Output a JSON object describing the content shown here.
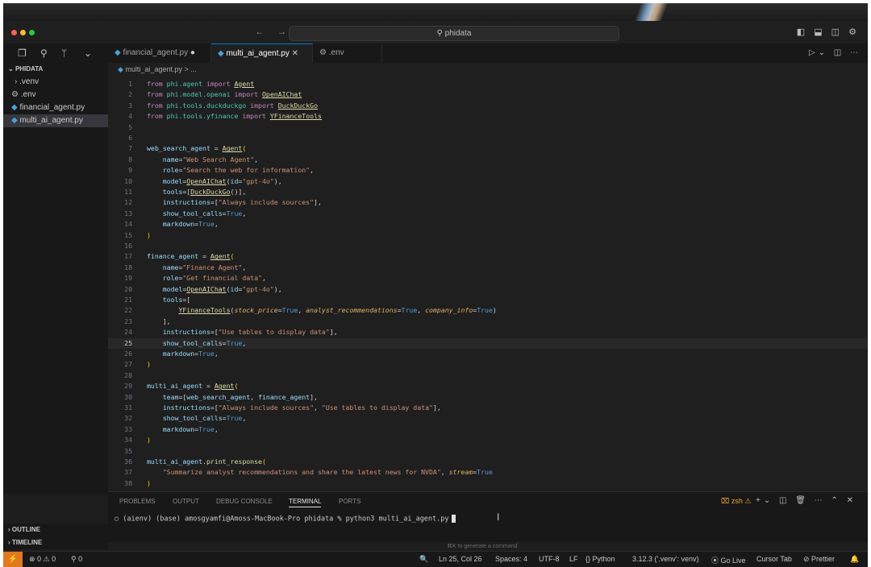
{
  "titlebar": {
    "search_text": "phidata",
    "nav_arrows": "← →"
  },
  "sidebar": {
    "header": "PHIDATA",
    "items": [
      {
        "label": ".venv",
        "icon": "chevron-right-icon"
      },
      {
        "label": ".env",
        "icon": "gear-icon"
      },
      {
        "label": "financial_agent.py",
        "icon": "python-icon"
      },
      {
        "label": "multi_ai_agent.py",
        "icon": "python-icon",
        "selected": true
      }
    ],
    "outline": "OUTLINE",
    "timeline": "TIMELINE"
  },
  "tabs": [
    {
      "label": "financial_agent.py",
      "modified": "●"
    },
    {
      "label": "multi_ai_agent.py",
      "close": "✕",
      "active": true
    },
    {
      "label": ".env"
    }
  ],
  "breadcrumb": "multi_ai_agent.py > ...",
  "editor": {
    "current_line": 25,
    "lines": [
      {
        "n": "1",
        "html": "<span class='kw'>from</span> <span class='mod'>phi.agent</span> <span class='kw'>import</span> <span class='cls'>Agent</span>"
      },
      {
        "n": "2",
        "html": "<span class='kw'>from</span> <span class='mod'>phi.model.openai</span> <span class='kw'>import</span> <span class='cls'>OpenAIChat</span>"
      },
      {
        "n": "3",
        "html": "<span class='kw'>from</span> <span class='mod'>phi.tools.duckduckgo</span> <span class='kw'>import</span> <span class='cls'>DuckDuckGo</span>"
      },
      {
        "n": "4",
        "html": "<span class='kw'>from</span> <span class='mod'>phi.tools.yfinance</span> <span class='kw'>import</span> <span class='cls'>YFinanceTools</span>"
      },
      {
        "n": "5",
        "html": ""
      },
      {
        "n": "6",
        "html": ""
      },
      {
        "n": "7",
        "html": "<span class='var'>web_search_agent</span> = <span class='cls'>Agent</span><span class='brk'>(</span>"
      },
      {
        "n": "8",
        "html": "    <span class='var'>name</span>=<span class='str'>\"Web Search Agent\"</span>,"
      },
      {
        "n": "9",
        "html": "    <span class='var'>role</span>=<span class='str'>\"Search the web for information\"</span>,"
      },
      {
        "n": "10",
        "html": "    <span class='var'>model</span>=<span class='cls'>OpenAIChat</span>(<span class='var'>id</span>=<span class='str'>\"gpt-4o\"</span>),"
      },
      {
        "n": "11",
        "html": "    <span class='var'>tools</span>=[<span class='cls'>DuckDuckGo</span>()],"
      },
      {
        "n": "12",
        "html": "    <span class='var'>instructions</span>=[<span class='str'>\"Always include sources\"</span>],"
      },
      {
        "n": "13",
        "html": "    <span class='var'>show_tool_calls</span>=<span class='const'>True</span>,"
      },
      {
        "n": "14",
        "html": "    <span class='var'>markdown</span>=<span class='const'>True</span>,"
      },
      {
        "n": "15",
        "html": "<span class='brk'>)</span>"
      },
      {
        "n": "16",
        "html": ""
      },
      {
        "n": "17",
        "html": "<span class='var'>finance_agent</span> = <span class='cls'>Agent</span><span class='brk'>(</span>"
      },
      {
        "n": "18",
        "html": "    <span class='var'>name</span>=<span class='str'>\"Finance Agent\"</span>,"
      },
      {
        "n": "19",
        "html": "    <span class='var'>role</span>=<span class='str'>\"Get financial data\"</span>,"
      },
      {
        "n": "20",
        "html": "    <span class='var'>model</span>=<span class='cls'>OpenAIChat</span>(<span class='var'>id</span>=<span class='str'>\"gpt-4o\"</span>),"
      },
      {
        "n": "21",
        "html": "    <span class='var'>tools</span>=["
      },
      {
        "n": "22",
        "html": "        <span class='cls'>YFinanceTools</span>(<span class='kwarg'>stock_price</span>=<span class='const'>True</span>, <span class='kwarg'>analyst_recommendations</span>=<span class='const'>True</span>, <span class='kwarg'>company_info</span>=<span class='const'>True</span>)"
      },
      {
        "n": "23",
        "html": "    ],"
      },
      {
        "n": "24",
        "html": "    <span class='var'>instructions</span>=[<span class='str'>\"Use tables to display data\"</span>],"
      },
      {
        "n": "25",
        "html": "    <span class='var'>show_tool_calls</span>=<span class='const'>True</span>,"
      },
      {
        "n": "26",
        "html": "    <span class='var'>markdown</span>=<span class='const'>True</span>,"
      },
      {
        "n": "27",
        "html": "<span class='brk'>)</span>"
      },
      {
        "n": "28",
        "html": ""
      },
      {
        "n": "29",
        "html": "<span class='var'>multi_ai_agent</span> = <span class='cls'>Agent</span><span class='brk'>(</span>"
      },
      {
        "n": "30",
        "html": "    <span class='var'>team</span>=[<span class='var'>web_search_agent</span>, <span class='var'>finance_agent</span>],"
      },
      {
        "n": "31",
        "html": "    <span class='var'>instructions</span>=[<span class='str'>\"Always include sources\"</span>, <span class='str'>\"Use tables to display data\"</span>],"
      },
      {
        "n": "32",
        "html": "    <span class='var'>show_tool_calls</span>=<span class='const'>True</span>,"
      },
      {
        "n": "33",
        "html": "    <span class='var'>markdown</span>=<span class='const'>True</span>,"
      },
      {
        "n": "34",
        "html": "<span class='brk'>)</span>"
      },
      {
        "n": "35",
        "html": ""
      },
      {
        "n": "36",
        "html": "<span class='var'>multi_ai_agent</span>.<span class='fn'>print_response</span><span class='brk'>(</span>"
      },
      {
        "n": "37",
        "html": "    <span class='str'>\"Summarize analyst recommendations and share the latest news for NVDA\"</span>, <span class='kwarg'>stream</span>=<span class='const'>True</span>"
      },
      {
        "n": "38",
        "html": "<span class='brk'>)</span>"
      },
      {
        "n": "39",
        "html": ""
      }
    ]
  },
  "panel": {
    "tabs": [
      "PROBLEMS",
      "OUTPUT",
      "DEBUG CONSOLE",
      "TERMINAL",
      "PORTS"
    ],
    "active_tab": "TERMINAL",
    "shell": "zsh",
    "terminal_line": "○ (aienv) (base) amosgyamfi@Amoss-MacBook-Pro phidata % python3 multi_ai_agent.py",
    "hint": "⌘K to generate a command"
  },
  "statusbar": {
    "remote_icon": "⚡",
    "problems": "⊗ 0 ⚠ 0",
    "ports": "⚲ 0",
    "zoom_icon": "🔍",
    "position": "Ln 25, Col 26",
    "spaces": "Spaces: 4",
    "encoding": "UTF-8",
    "eol": "LF",
    "language": "{} Python",
    "interpreter": "3.12.3 ('.venv': venv)",
    "golive": "⦿ Go Live",
    "cursortab": "Cursor Tab",
    "prettier": "⊘ Prettier",
    "bell": "🔔"
  }
}
